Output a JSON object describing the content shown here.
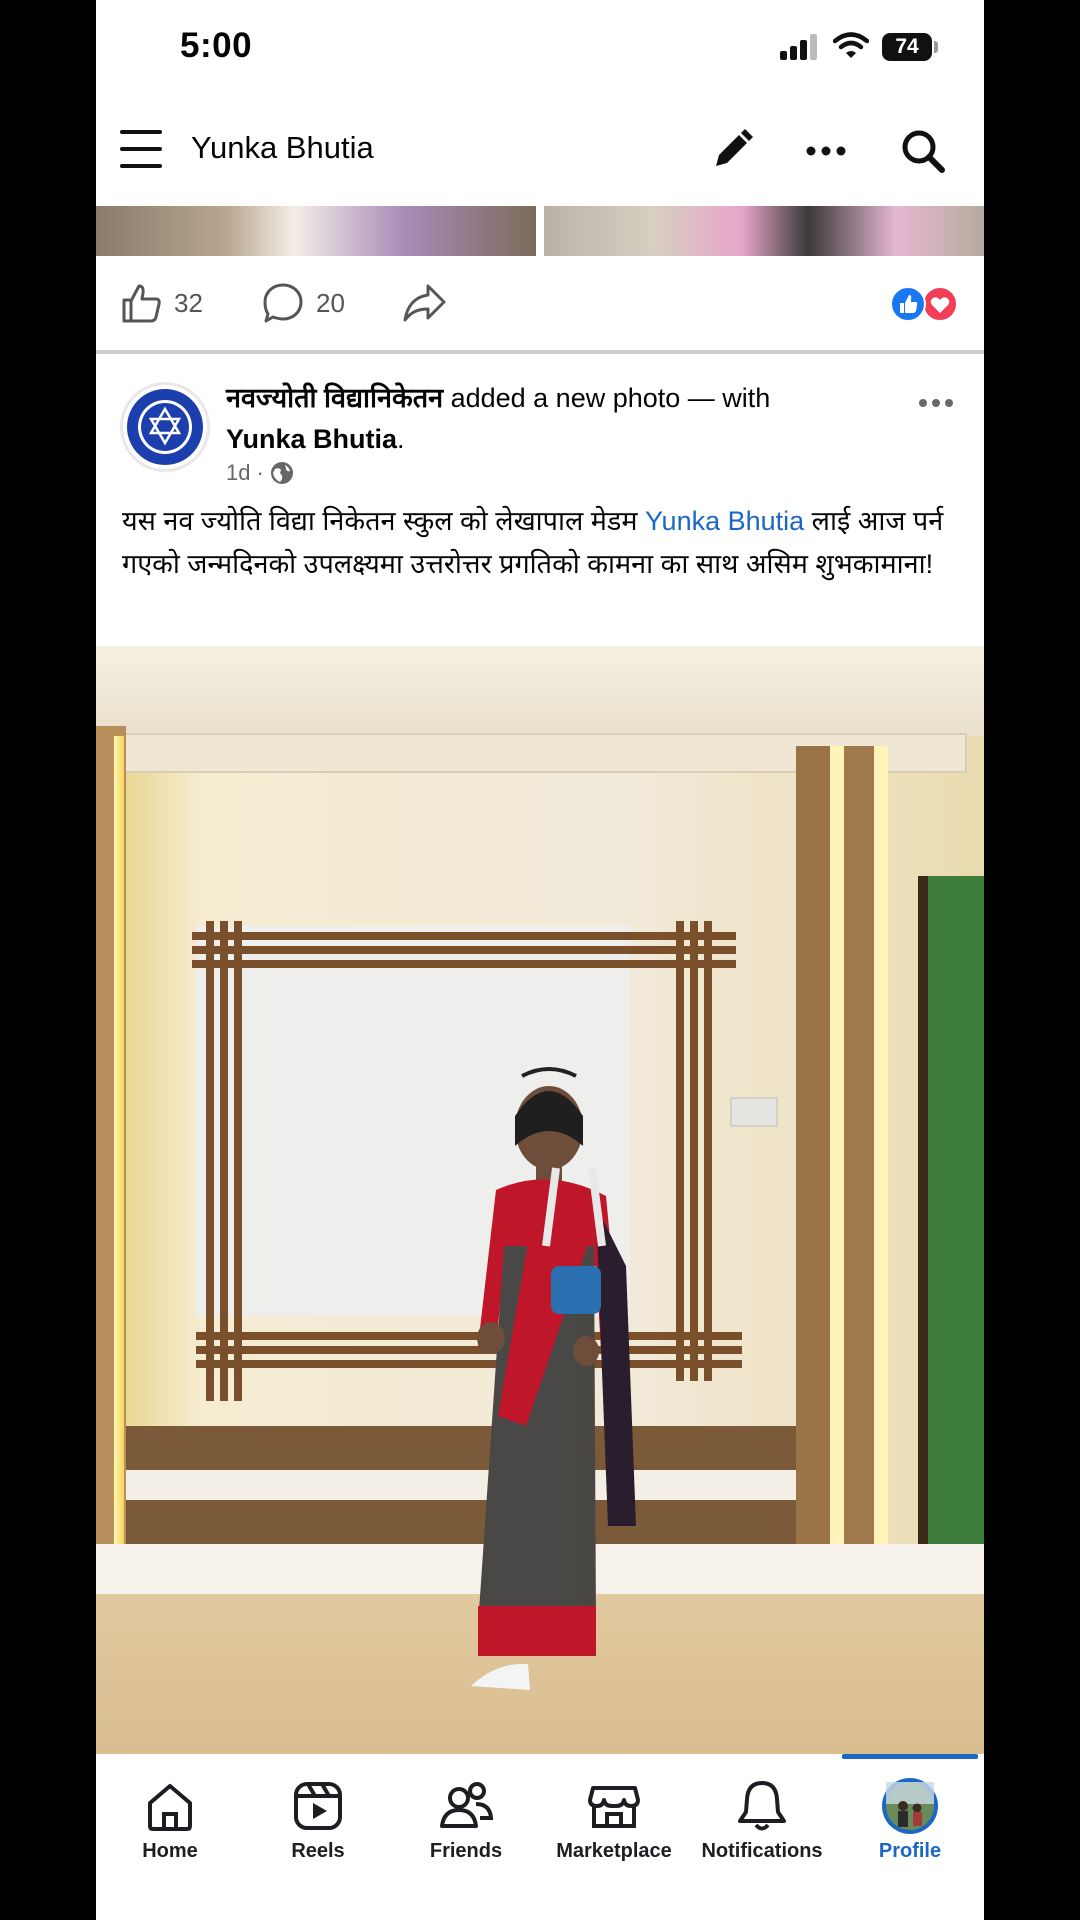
{
  "status": {
    "time": "5:00",
    "battery": "74"
  },
  "header": {
    "title": "Yunka Bhutia",
    "menu_icon": "hamburger-icon",
    "edit_icon": "pencil-icon",
    "more_icon": "more-icon",
    "search_icon": "search-icon"
  },
  "previous_post": {
    "likes": "32",
    "comments": "20"
  },
  "post": {
    "author": "नवज्योती विद्यानिकेतन",
    "action": " added a new photo — with",
    "tagged": "Yunka Bhutia",
    "tagged_suffix": ".",
    "age": "1d",
    "audience": "globe-icon",
    "caption_before": "यस नव ज्योति विद्या निकेतन स्कुल को लेखापाल मेडम ",
    "caption_mention": "Yunka Bhutia",
    "caption_after": " लाई आज पर्न गएको जन्मदिनको उपलक्ष्यमा उत्तरोत्तर प्रगतिको कामना का साथ असिम शुभकामाना!"
  },
  "nav": [
    {
      "label": "Home",
      "icon": "home-icon"
    },
    {
      "label": "Reels",
      "icon": "reels-icon"
    },
    {
      "label": "Friends",
      "icon": "friends-icon"
    },
    {
      "label": "Marketplace",
      "icon": "marketplace-icon"
    },
    {
      "label": "Notifications",
      "icon": "bell-icon"
    },
    {
      "label": "Profile",
      "icon": "profile-avatar",
      "active": true
    }
  ],
  "colors": {
    "accent": "#1b67c4",
    "like_blue": "#1877f2",
    "love_red": "#f33e58"
  }
}
